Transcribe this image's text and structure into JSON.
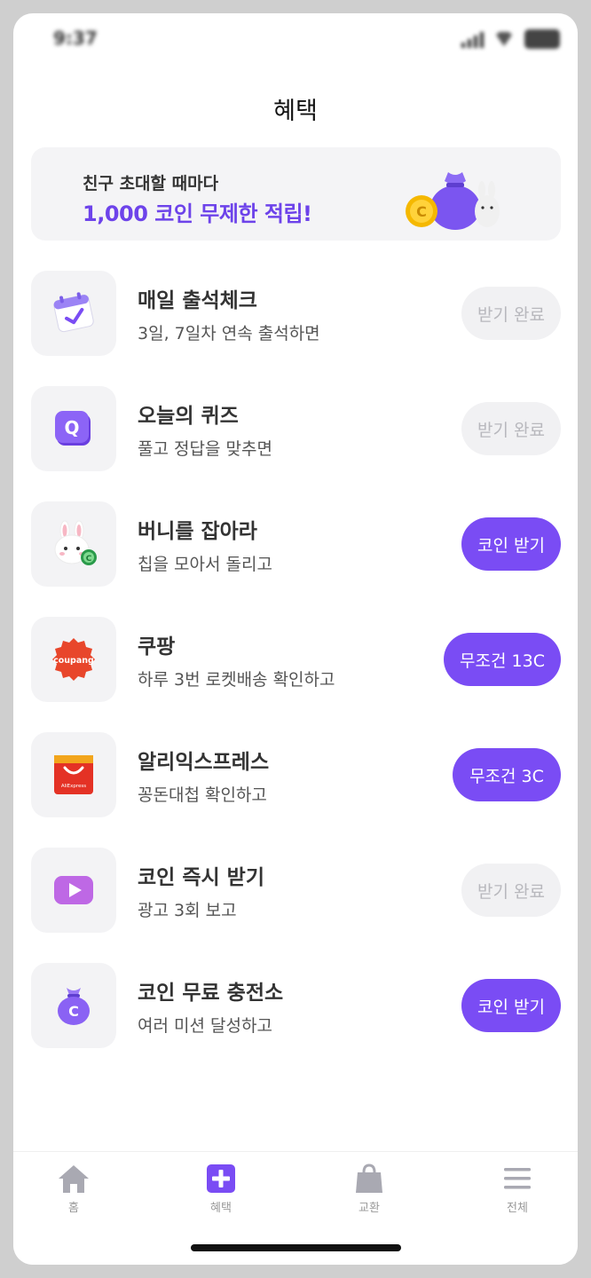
{
  "status_bar": {
    "time": "9:37"
  },
  "header": {
    "title": "혜택"
  },
  "banner": {
    "line1": "친구 초대할 때마다",
    "line2": "1,000 코인 무제한 적립!"
  },
  "rows": [
    {
      "title": "매일 출석체크",
      "subtitle": "3일, 7일차 연속 출석하면",
      "button": "받기 완료",
      "state": "done",
      "icon": "calendar-check-icon"
    },
    {
      "title": "오늘의 퀴즈",
      "subtitle": "풀고 정답을 맞추면",
      "button": "받기 완료",
      "state": "done",
      "icon": "quiz-q-icon"
    },
    {
      "title": "버니를 잡아라",
      "subtitle": "칩을 모아서 돌리고",
      "button": "코인 받기",
      "state": "active",
      "icon": "bunny-icon"
    },
    {
      "title": "쿠팡",
      "subtitle": "하루 3번 로켓배송 확인하고",
      "button": "무조건 13C",
      "state": "active",
      "icon": "coupang-icon"
    },
    {
      "title": "알리익스프레스",
      "subtitle": "꽁돈대첩 확인하고",
      "button": "무조건 3C",
      "state": "active",
      "icon": "aliexpress-icon"
    },
    {
      "title": "코인 즉시 받기",
      "subtitle": "광고 3회 보고",
      "button": "받기 완료",
      "state": "done",
      "icon": "video-play-icon"
    },
    {
      "title": "코인 무료 충전소",
      "subtitle": "여러 미션 달성하고",
      "button": "코인 받기",
      "state": "active",
      "icon": "coin-bag-icon"
    }
  ],
  "icon_text": {
    "coupang": "coupang",
    "aliexpress": "AliExpress",
    "coin": "C",
    "quiz": "Q"
  },
  "tabs": [
    {
      "label": "홈",
      "icon": "home-icon"
    },
    {
      "label": "혜택",
      "icon": "plus-square-icon",
      "selected": true
    },
    {
      "label": "교환",
      "icon": "shopping-bag-icon"
    },
    {
      "label": "전체",
      "icon": "menu-icon"
    }
  ],
  "colors": {
    "accent": "#7a4cf4",
    "banner_accent": "#6d43ea",
    "done_bg": "#f1f1f3",
    "coupang": "#e8462b",
    "aliexpress": "#e43225"
  }
}
